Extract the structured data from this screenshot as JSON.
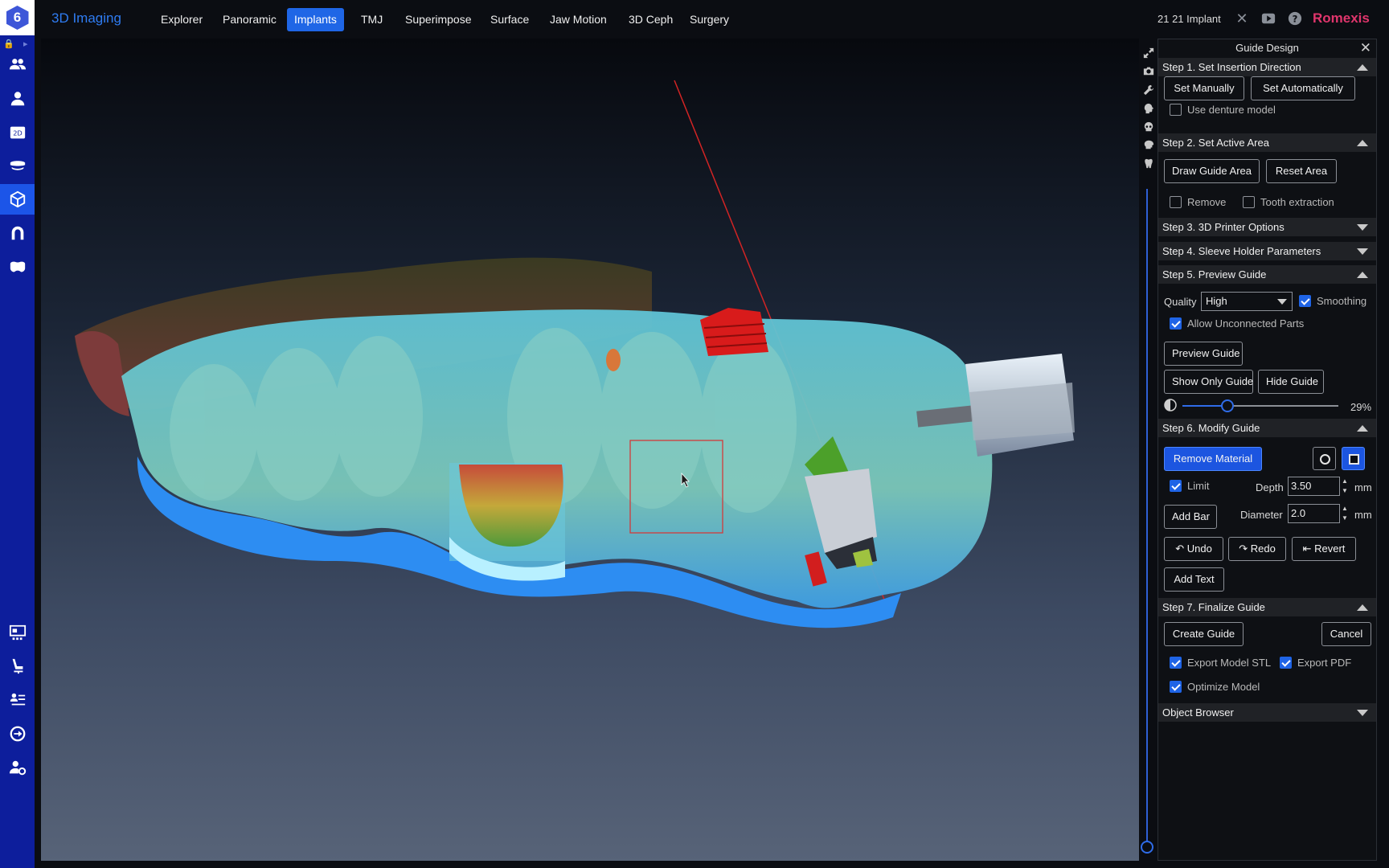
{
  "app": {
    "title": "3D Imaging",
    "brand": "Romexis",
    "case_label": "21 21 Implant",
    "accent": "#1f66e6",
    "brand_color": "#e0356c"
  },
  "nav": {
    "tabs": [
      {
        "label": "Explorer",
        "active": false
      },
      {
        "label": "Panoramic",
        "active": false
      },
      {
        "label": "Implants",
        "active": true
      },
      {
        "label": "TMJ",
        "active": false
      },
      {
        "label": "Superimpose",
        "active": false
      },
      {
        "label": "Surface",
        "active": false
      },
      {
        "label": "Jaw Motion",
        "active": false
      },
      {
        "label": "3D Ceph",
        "active": false
      },
      {
        "label": "Surgery",
        "active": false
      }
    ]
  },
  "sidebar": {
    "icons": [
      "users-icon",
      "patient-icon",
      "2d-icon",
      "dentition-icon",
      "3d-cube-icon",
      "arch-icon",
      "teeth-icon",
      "gallery-icon",
      "dental-chair-icon",
      "worklist-icon",
      "login-icon",
      "user-settings-icon"
    ]
  },
  "toolbar_icons": [
    "close-icon",
    "video-icon",
    "help-icon"
  ],
  "view_tools": [
    "expand-icon",
    "camera-icon",
    "wrench-icon",
    "head-icon",
    "skull-icon",
    "brain-icon",
    "tooth-icon"
  ],
  "panel": {
    "title": "Guide Design",
    "step1": {
      "title": "Step 1. Set Insertion Direction",
      "set_manually": "Set Manually",
      "set_automatically": "Set Automatically",
      "use_denture": "Use denture model"
    },
    "step2": {
      "title": "Step 2. Set Active Area",
      "draw_area": "Draw Guide Area",
      "reset_area": "Reset Area",
      "remove": "Remove",
      "tooth_extraction": "Tooth extraction"
    },
    "step3": {
      "title": "Step 3. 3D Printer Options"
    },
    "step4": {
      "title": "Step 4. Sleeve Holder Parameters"
    },
    "step5": {
      "title": "Step 5. Preview Guide",
      "quality_label": "Quality",
      "quality_value": "High",
      "smoothing": "Smoothing",
      "allow_unconnected": "Allow Unconnected Parts",
      "preview_guide": "Preview Guide",
      "show_only_guide": "Show Only Guide",
      "hide_guide": "Hide Guide",
      "transparency_value": "29%",
      "transparency_fraction": 0.29
    },
    "step6": {
      "title": "Step 6. Modify Guide",
      "remove_material": "Remove Material",
      "limit": "Limit",
      "depth_label": "Depth",
      "depth_value": "3.50",
      "unit": "mm",
      "diameter_label": "Diameter",
      "diameter_value": "2.0",
      "add_bar": "Add Bar",
      "undo": "Undo",
      "redo": "Redo",
      "revert": "Revert",
      "add_text": "Add Text"
    },
    "step7": {
      "title": "Step 7. Finalize Guide",
      "create_guide": "Create Guide",
      "cancel": "Cancel",
      "export_stl": "Export Model STL",
      "export_pdf": "Export PDF",
      "optimize": "Optimize Model"
    },
    "object_browser": {
      "title": "Object Browser"
    }
  }
}
